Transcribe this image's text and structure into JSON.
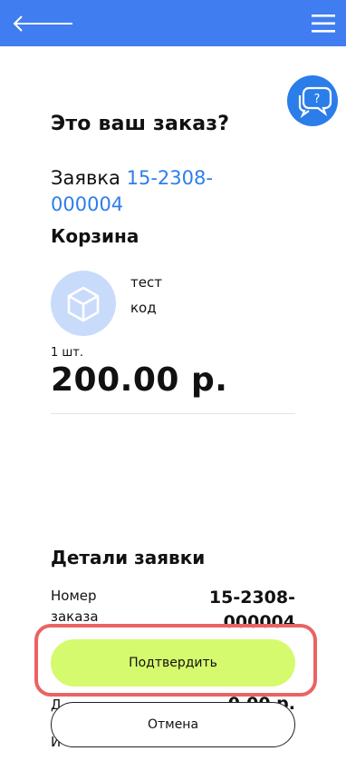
{
  "header": {
    "back_icon": "arrow-left-icon",
    "menu_icon": "hamburger-menu-icon",
    "bar_color": "#3f7df0"
  },
  "help": {
    "icon": "chat-question-icon",
    "glyph": "?"
  },
  "order": {
    "title": "Это ваш заказ?",
    "request_label": "Заявка",
    "request_number": "15-2308-000004"
  },
  "cart": {
    "title": "Корзина",
    "item": {
      "icon": "package-box-icon",
      "name": "тест",
      "code": "код",
      "quantity": "1 шт.",
      "price": "200.00 р."
    }
  },
  "details": {
    "title": "Детали заявки",
    "order_number_label": "Номер заказа",
    "order_number_value": "15-2308-000004",
    "peek_row_2_label": "Д",
    "peek_row_2_value": "0.00 р.",
    "peek_row_3_label": "И"
  },
  "actions": {
    "confirm": "Подтвердить",
    "cancel": "Отмена",
    "confirm_color": "#d5fa6d",
    "highlight_color": "#ea6363"
  }
}
